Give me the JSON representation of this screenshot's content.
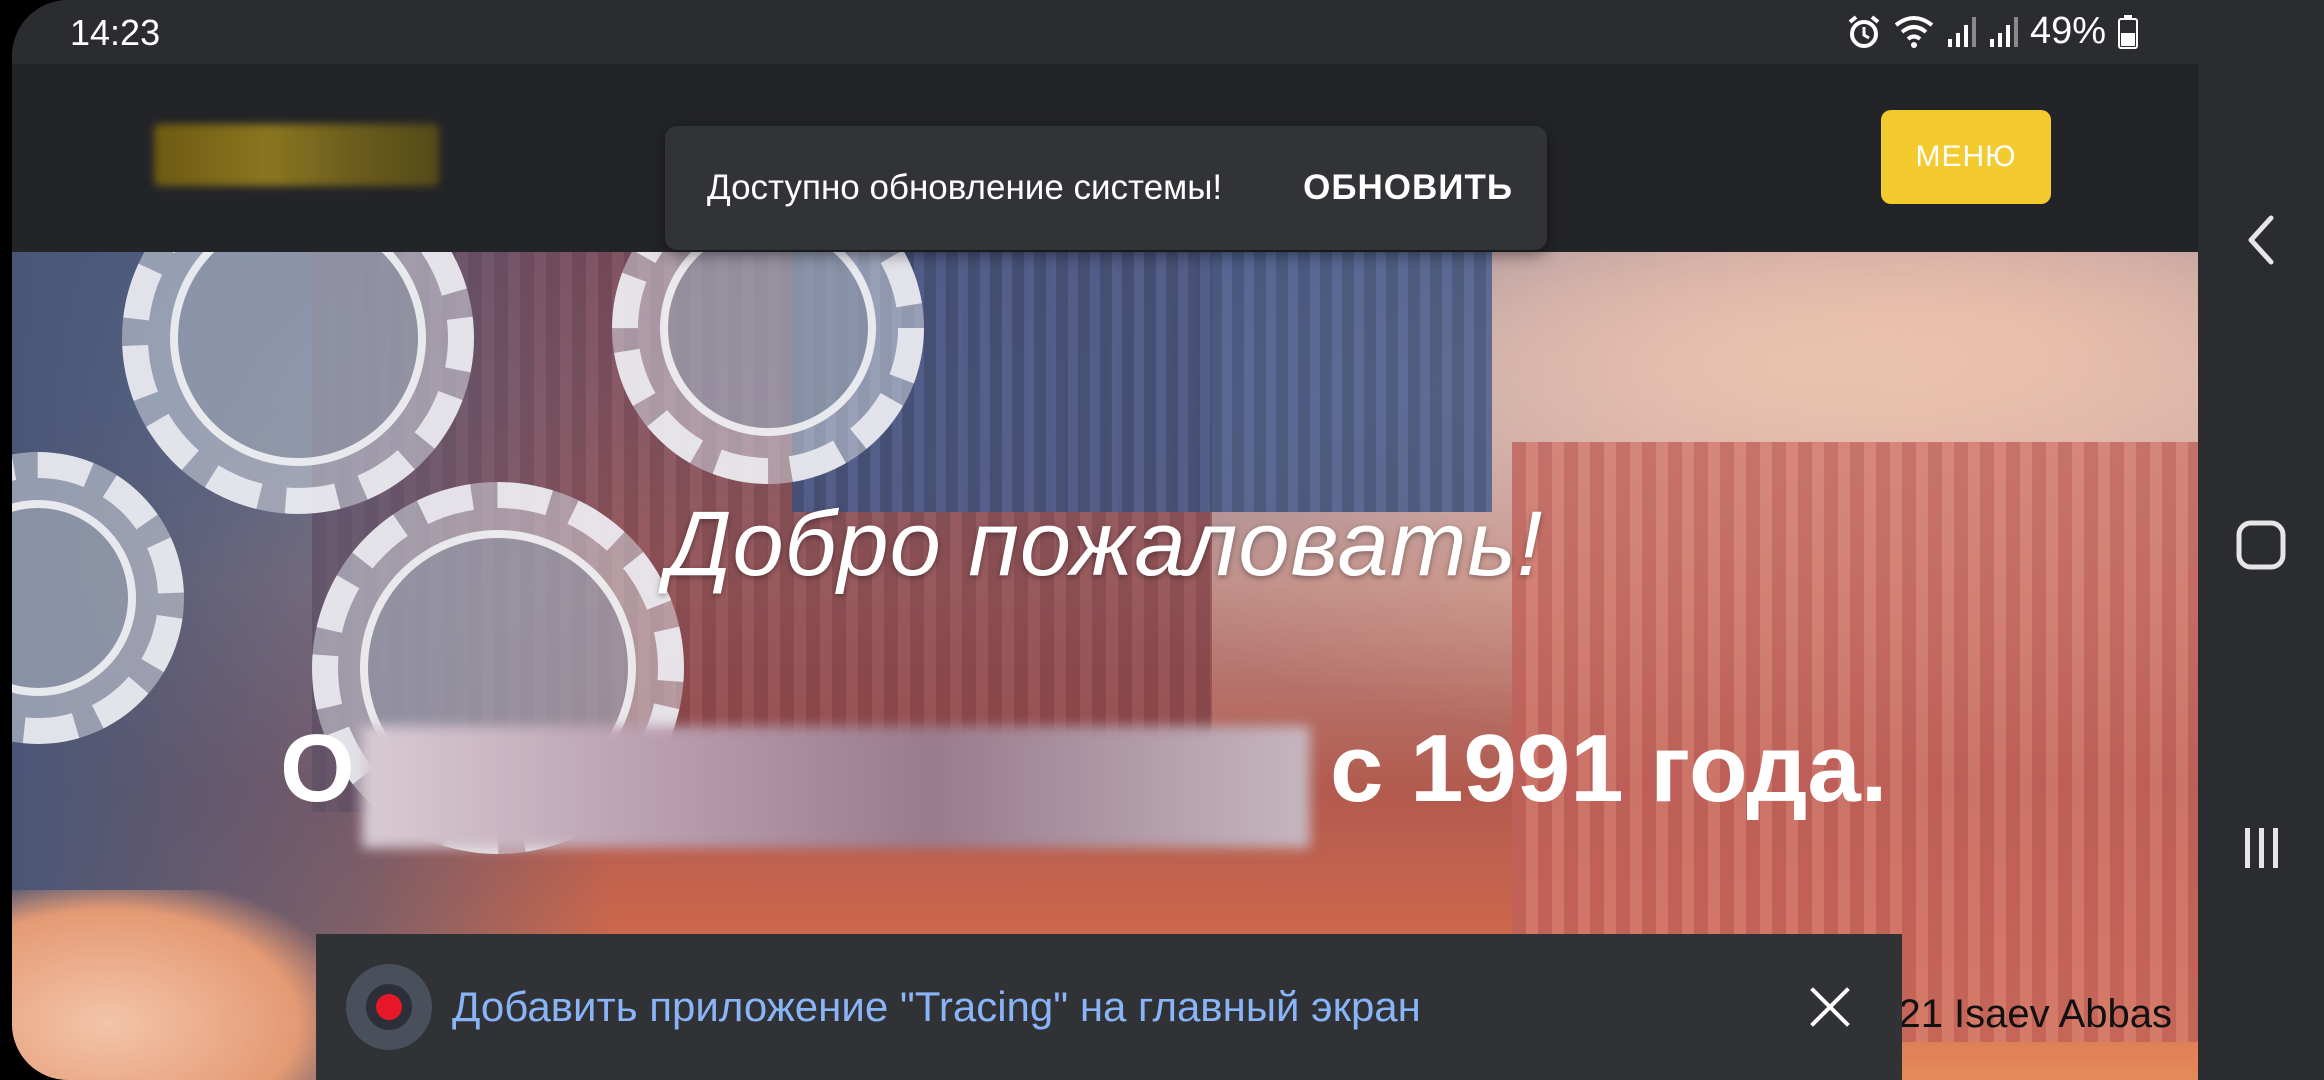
{
  "status_bar": {
    "time": "14:23",
    "battery": "49%",
    "icons": [
      "alarm-icon",
      "wifi-icon",
      "signal-icon",
      "signal-icon",
      "battery-icon"
    ]
  },
  "header": {
    "menu_label": "МЕНЮ",
    "accent_color": "#f4cb2f"
  },
  "snackbar": {
    "message": "Доступно обновление системы!",
    "action": "ОБНОВИТЬ"
  },
  "hero": {
    "greeting": "Добро пожаловать!",
    "headline_prefix": "О",
    "headline_suffix": "с 1991 года."
  },
  "footer": {
    "copyright": "21 Isaev Abbas"
  },
  "install_banner": {
    "text": "Добавить приложение \"Tracing\" на главный экран",
    "text_color": "#8ab4f8"
  },
  "nav_bar": {
    "icons": [
      "back-icon",
      "home-icon",
      "recents-icon"
    ]
  }
}
